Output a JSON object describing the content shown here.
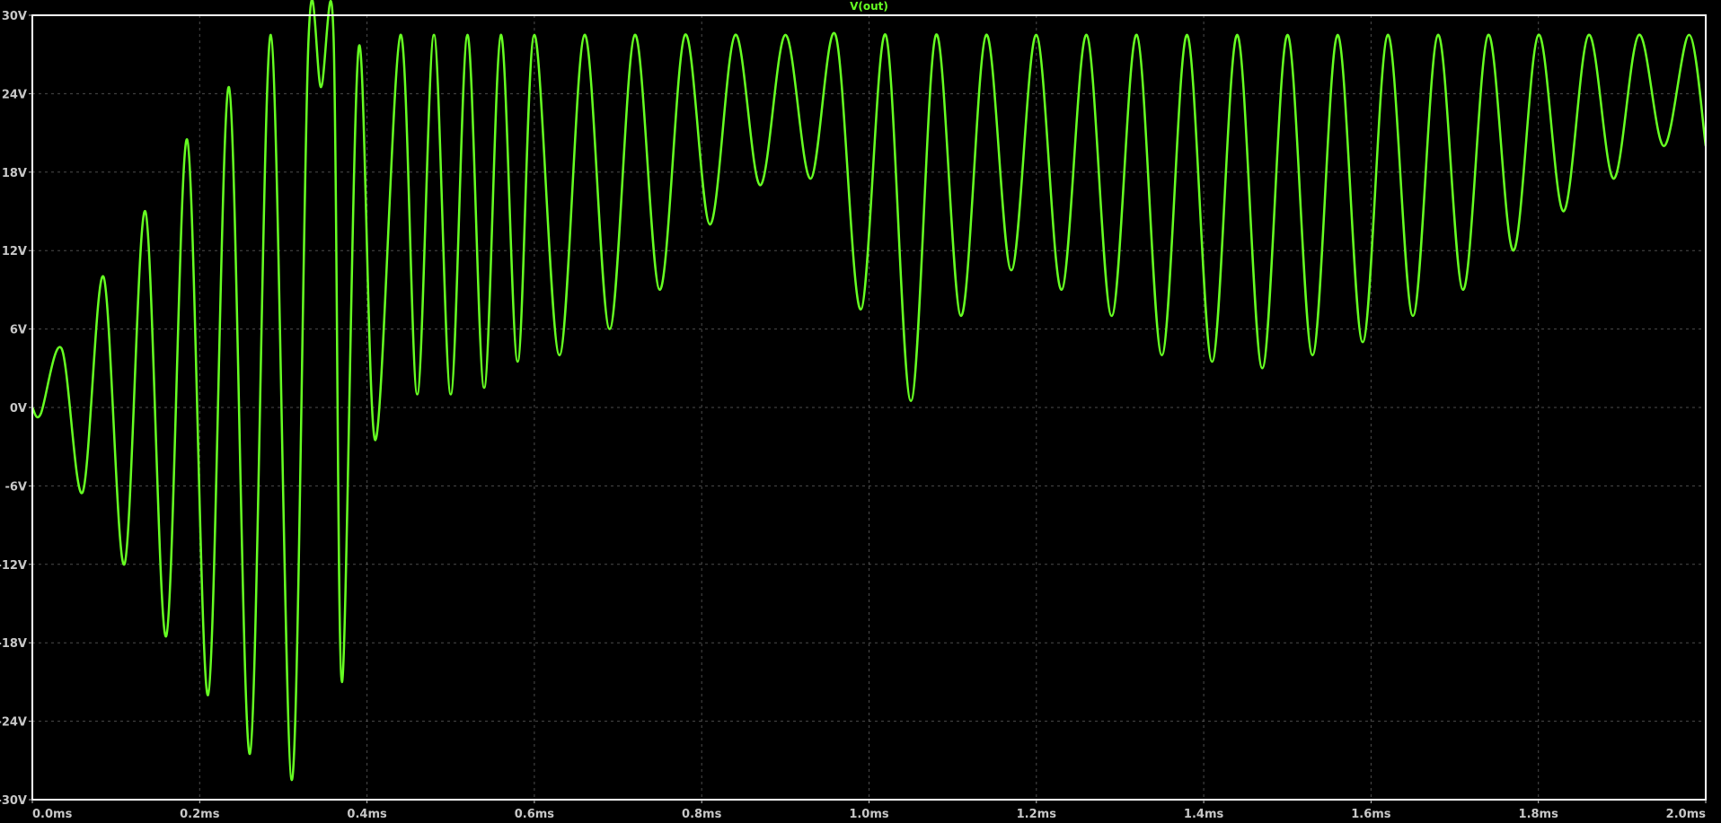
{
  "window": {
    "background": "#000000",
    "frame_color": "#ffffff",
    "grid": true,
    "grid_color": "#8a8a8a",
    "tick_label_color": "#c8c8c8"
  },
  "chart_data": {
    "type": "line",
    "title": "V(out)",
    "xlabel": "",
    "ylabel": "",
    "xlim": [
      0,
      2.0
    ],
    "ylim": [
      -30,
      30
    ],
    "x_unit": "ms",
    "y_unit": "V",
    "x_ticks": [
      {
        "value": 0.0,
        "label": "0.0ms"
      },
      {
        "value": 0.2,
        "label": "0.2ms"
      },
      {
        "value": 0.4,
        "label": "0.4ms"
      },
      {
        "value": 0.6,
        "label": "0.6ms"
      },
      {
        "value": 0.8,
        "label": "0.8ms"
      },
      {
        "value": 1.0,
        "label": "1.0ms"
      },
      {
        "value": 1.2,
        "label": "1.2ms"
      },
      {
        "value": 1.4,
        "label": "1.4ms"
      },
      {
        "value": 1.6,
        "label": "1.6ms"
      },
      {
        "value": 1.8,
        "label": "1.8ms"
      },
      {
        "value": 2.0,
        "label": "2.0ms"
      }
    ],
    "y_ticks": [
      {
        "value": 30,
        "label": "30V"
      },
      {
        "value": 24,
        "label": "24V"
      },
      {
        "value": 18,
        "label": "18V"
      },
      {
        "value": 12,
        "label": "12V"
      },
      {
        "value": 6,
        "label": "6V"
      },
      {
        "value": 0,
        "label": "0V"
      },
      {
        "value": -6,
        "label": "-6V"
      },
      {
        "value": -12,
        "label": "-12V"
      },
      {
        "value": -18,
        "label": "-18V"
      },
      {
        "value": -24,
        "label": "-24V"
      },
      {
        "value": -30,
        "label": "-30V"
      }
    ],
    "series": [
      {
        "name": "V(out)",
        "color": "#66ff22",
        "x": [
          0,
          0.01,
          0.035,
          0.06,
          0.085,
          0.11,
          0.135,
          0.16,
          0.185,
          0.21,
          0.235,
          0.26,
          0.285,
          0.31,
          0.33,
          0.345,
          0.36,
          0.37,
          0.39,
          0.41,
          0.44,
          0.46,
          0.48,
          0.5,
          0.52,
          0.54,
          0.56,
          0.58,
          0.6,
          0.63,
          0.66,
          0.69,
          0.72,
          0.75,
          0.78,
          0.81,
          0.84,
          0.87,
          0.9,
          0.93,
          0.96,
          0.99,
          1.02,
          1.05,
          1.08,
          1.11,
          1.14,
          1.17,
          1.2,
          1.23,
          1.26,
          1.29,
          1.32,
          1.35,
          1.38,
          1.41,
          1.44,
          1.47,
          1.5,
          1.53,
          1.56,
          1.59,
          1.62,
          1.65,
          1.68,
          1.71,
          1.74,
          1.77,
          1.8,
          1.83,
          1.86,
          1.89,
          1.92,
          1.95,
          1.98,
          2.0
        ],
        "y": [
          0,
          -0.5,
          4.5,
          -6.5,
          10,
          -12,
          15,
          -17.5,
          20.5,
          -22,
          24.5,
          -26.5,
          28.5,
          -28.5,
          28,
          24.5,
          28.5,
          -21,
          27.5,
          -2.5,
          28.5,
          1,
          28.5,
          1,
          28.5,
          1.5,
          28.5,
          3.5,
          28.5,
          4,
          28.5,
          6,
          28.5,
          9,
          28.5,
          14,
          28.5,
          17,
          28.5,
          17.5,
          28.5,
          7.5,
          28.5,
          0.5,
          28.5,
          7,
          28.5,
          10.5,
          28.5,
          9,
          28.5,
          7,
          28.5,
          4,
          28.5,
          3.5,
          28.5,
          3,
          28.5,
          4,
          28.5,
          5,
          28.5,
          7,
          28.5,
          9,
          28.5,
          12,
          28.5,
          15,
          28.5,
          17.5,
          28.5,
          20,
          28.5,
          20
        ]
      }
    ]
  }
}
